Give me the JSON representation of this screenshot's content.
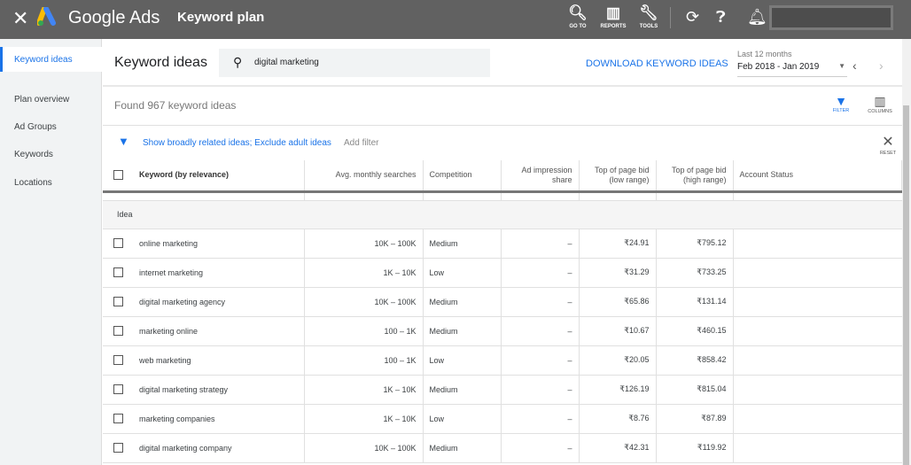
{
  "topbar": {
    "close_icon": "close-icon",
    "brand": "Google Ads",
    "title": "Keyword plan",
    "tools": [
      {
        "icon": "search-icon",
        "label": "GO TO"
      },
      {
        "icon": "reports-icon",
        "label": "REPORTS"
      },
      {
        "icon": "wrench-icon",
        "label": "TOOLS"
      }
    ]
  },
  "sidebar": {
    "items": [
      {
        "label": "Keyword ideas",
        "active": true
      },
      {
        "label": "Plan overview"
      },
      {
        "label": "Ad Groups"
      },
      {
        "label": "Keywords"
      },
      {
        "label": "Locations"
      }
    ]
  },
  "header": {
    "title": "Keyword ideas",
    "search_value": "digital marketing",
    "download_label": "DOWNLOAD KEYWORD IDEAS",
    "date_label": "Last 12 months",
    "date_range": "Feb 2018 - Jan 2019"
  },
  "toolbar": {
    "found": "Found 967 keyword ideas",
    "filter_label": "FILTER",
    "columns_label": "COLUMNS",
    "filter_text": "Show broadly related ideas; Exclude adult ideas",
    "add_filter": "Add filter",
    "reset_label": "RESET"
  },
  "table": {
    "headers": [
      "Keyword (by relevance)",
      "Avg. monthly searches",
      "Competition",
      "Ad impression share",
      "Top of page bid (low range)",
      "Top of page bid (high range)",
      "Account Status"
    ],
    "group": "Idea",
    "rows": [
      [
        "online marketing",
        "10K – 100K",
        "Medium",
        "–",
        "₹24.91",
        "₹795.12"
      ],
      [
        "internet marketing",
        "1K – 10K",
        "Low",
        "–",
        "₹31.29",
        "₹733.25"
      ],
      [
        "digital marketing agency",
        "10K – 100K",
        "Medium",
        "–",
        "₹65.86",
        "₹131.14"
      ],
      [
        "marketing online",
        "100 – 1K",
        "Medium",
        "–",
        "₹10.67",
        "₹460.15"
      ],
      [
        "web marketing",
        "100 – 1K",
        "Low",
        "–",
        "₹20.05",
        "₹858.42"
      ],
      [
        "digital marketing strategy",
        "1K – 10K",
        "Medium",
        "–",
        "₹126.19",
        "₹815.04"
      ],
      [
        "marketing companies",
        "1K – 10K",
        "Low",
        "–",
        "₹8.76",
        "₹87.89"
      ],
      [
        "digital marketing company",
        "10K – 100K",
        "Medium",
        "–",
        "₹42.31",
        "₹119.92"
      ]
    ]
  },
  "colors": {
    "accent": "#1a73e8",
    "topbar": "#616161"
  }
}
